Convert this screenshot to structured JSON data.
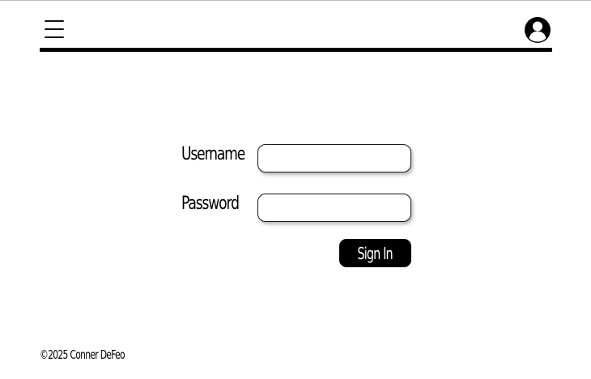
{
  "header": {
    "menu_icon": "hamburger-menu-icon",
    "profile_icon": "account-circle-icon"
  },
  "login_form": {
    "username_label": "Username",
    "username_value": "",
    "password_label": "Password",
    "password_value": "",
    "sign_in_label": "Sign In"
  },
  "footer": {
    "copyright": "©2025 Conner DeFeo"
  }
}
